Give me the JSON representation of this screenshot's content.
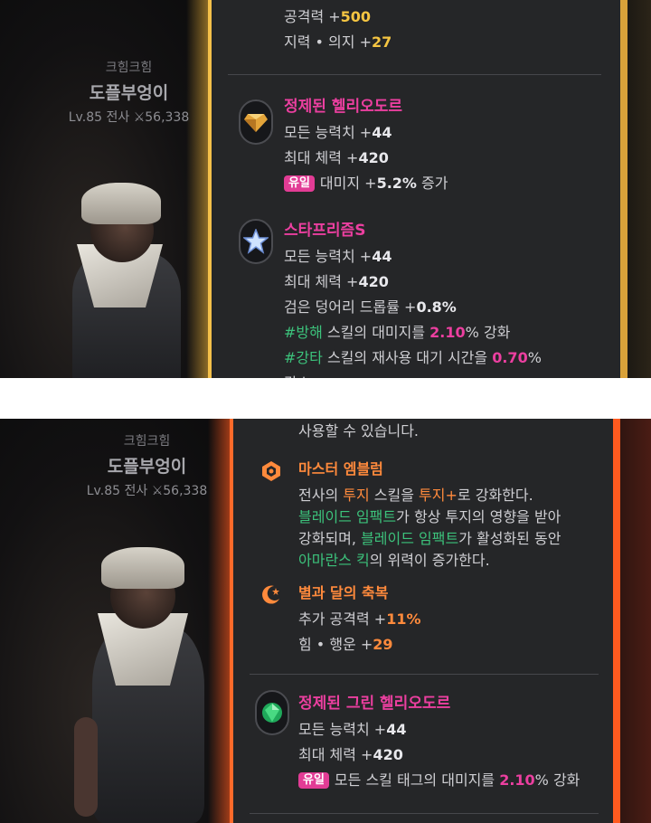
{
  "character": {
    "guild": "크힘크힘",
    "name": "도플부엉이",
    "level": "Lv.85",
    "class": "전사",
    "power_icon": "crossed-swords-icon",
    "power": "56,338"
  },
  "top": {
    "lines_before": [
      {
        "label": "공격력 +",
        "value": "500"
      },
      {
        "label": "지력 • 의지 +",
        "value": "27"
      }
    ],
    "helio": {
      "icon": "orange-gem-icon",
      "name": "정제된 헬리오도르",
      "stat1_label": "모든 능력치 +",
      "stat1_value": "44",
      "stat2_label": "최대 체력 +",
      "stat2_value": "420",
      "badge": "유일",
      "effect_label": "대미지 +",
      "effect_value": "5.2%",
      "effect_suffix": " 증가"
    },
    "starprism": {
      "icon": "star-prism-icon",
      "name": "스타프리즘S",
      "stat1_label": "모든 능력치 +",
      "stat1_value": "44",
      "stat2_label": "최대 체력 +",
      "stat2_value": "420",
      "stat3_label": "검은 덩어리 드롭률 +",
      "stat3_value": "0.8%",
      "skill1_tag": "#방해",
      "skill1_mid": " 스킬의 대미지를 ",
      "skill1_value": "2.10",
      "skill1_suffix": "% 강화",
      "skill2_tag": "#강타",
      "skill2_mid": " 스킬의 재사용 대기 시간을 ",
      "skill2_value": "0.70",
      "skill2_suffix": "%",
      "cut_line": "감소"
    }
  },
  "bottom": {
    "intro_line": "사용할 수 있습니다.",
    "master_emblem": {
      "icon": "emblem-icon",
      "name": "마스터 엠블럼",
      "l1_a": "전사의 ",
      "l1_b": "투지",
      "l1_c": " 스킬을 ",
      "l1_d": "투지+",
      "l1_e": "로 강화한다.",
      "l2_a": "블레이드 임팩트",
      "l2_b": "가 항상 투지의 영향을 받아",
      "l3_a": "강화되며, ",
      "l3_b": "블레이드 임팩트",
      "l3_c": "가 활성화된 동안",
      "l4_a": "아마란스 킥",
      "l4_b": "의 위력이 증가한다."
    },
    "star_moon": {
      "icon": "moon-star-icon",
      "name": "별과 달의 축복",
      "stat1_label": "추가 공격력 +",
      "stat1_value": "11%",
      "stat2_label": "힘 • 행운 +",
      "stat2_value": "29"
    },
    "green_helio": {
      "icon": "green-gem-icon",
      "name": "정제된 그린 헬리오도르",
      "stat1_label": "모든 능력치 +",
      "stat1_value": "44",
      "stat2_label": "최대 체력 +",
      "stat2_value": "420",
      "badge": "유일",
      "effect_label": "모든 스킬 태그의 대미지를 ",
      "effect_value": "2.10",
      "effect_suffix": "% 강화"
    }
  },
  "colors": {
    "top_frame": "#f0b53a",
    "bottom_frame": "#ff5a1f",
    "accent_pink": "#ec3fa0",
    "accent_gold": "#f5c542",
    "accent_green": "#3cc27b",
    "accent_orange": "#ff8a3c"
  }
}
